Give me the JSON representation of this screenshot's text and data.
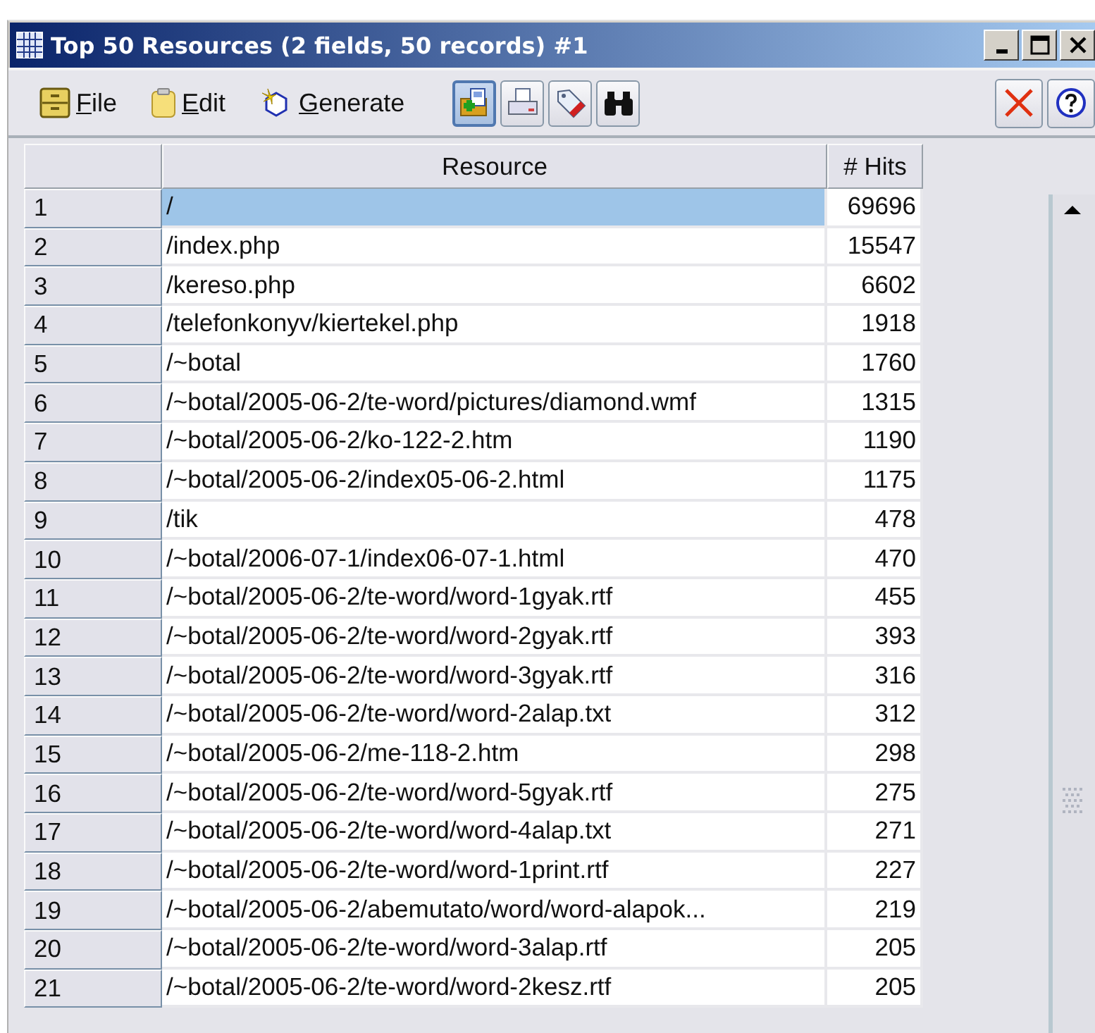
{
  "window": {
    "title": "Top 50 Resources (2 fields, 50 records) #1"
  },
  "menu": [
    {
      "label": "File",
      "kind": "file"
    },
    {
      "label": "Edit",
      "kind": "edit"
    },
    {
      "label": "Generate",
      "kind": "generate"
    }
  ],
  "toolbar": [
    {
      "kind": "add",
      "selected": true
    },
    {
      "kind": "print",
      "selected": false
    },
    {
      "kind": "tag",
      "selected": false
    },
    {
      "kind": "find",
      "selected": false
    }
  ],
  "actions": [
    {
      "kind": "close"
    },
    {
      "kind": "help"
    }
  ],
  "table": {
    "columns": [
      "Resource",
      "# Hits"
    ],
    "rows": [
      {
        "index": "1",
        "resource": "/",
        "hits": "69696",
        "selected": true
      },
      {
        "index": "2",
        "resource": "/index.php",
        "hits": "15547",
        "selected": false
      },
      {
        "index": "3",
        "resource": "/kereso.php",
        "hits": "6602",
        "selected": false
      },
      {
        "index": "4",
        "resource": "/telefonkonyv/kiertekel.php",
        "hits": "1918",
        "selected": false
      },
      {
        "index": "5",
        "resource": "/~botal",
        "hits": "1760",
        "selected": false
      },
      {
        "index": "6",
        "resource": "/~botal/2005-06-2/te-word/pictures/diamond.wmf",
        "hits": "1315",
        "selected": false
      },
      {
        "index": "7",
        "resource": "/~botal/2005-06-2/ko-122-2.htm",
        "hits": "1190",
        "selected": false
      },
      {
        "index": "8",
        "resource": "/~botal/2005-06-2/index05-06-2.html",
        "hits": "1175",
        "selected": false
      },
      {
        "index": "9",
        "resource": "/tik",
        "hits": "478",
        "selected": false
      },
      {
        "index": "10",
        "resource": "/~botal/2006-07-1/index06-07-1.html",
        "hits": "470",
        "selected": false
      },
      {
        "index": "11",
        "resource": "/~botal/2005-06-2/te-word/word-1gyak.rtf",
        "hits": "455",
        "selected": false
      },
      {
        "index": "12",
        "resource": "/~botal/2005-06-2/te-word/word-2gyak.rtf",
        "hits": "393",
        "selected": false
      },
      {
        "index": "13",
        "resource": "/~botal/2005-06-2/te-word/word-3gyak.rtf",
        "hits": "316",
        "selected": false
      },
      {
        "index": "14",
        "resource": "/~botal/2005-06-2/te-word/word-2alap.txt",
        "hits": "312",
        "selected": false
      },
      {
        "index": "15",
        "resource": "/~botal/2005-06-2/me-118-2.htm",
        "hits": "298",
        "selected": false
      },
      {
        "index": "16",
        "resource": "/~botal/2005-06-2/te-word/word-5gyak.rtf",
        "hits": "275",
        "selected": false
      },
      {
        "index": "17",
        "resource": "/~botal/2005-06-2/te-word/word-4alap.txt",
        "hits": "271",
        "selected": false
      },
      {
        "index": "18",
        "resource": "/~botal/2005-06-2/te-word/word-1print.rtf",
        "hits": "227",
        "selected": false
      },
      {
        "index": "19",
        "resource": "/~botal/2005-06-2/abemutato/word/word-alapok...",
        "hits": "219",
        "selected": false
      },
      {
        "index": "20",
        "resource": "/~botal/2005-06-2/te-word/word-3alap.rtf",
        "hits": "205",
        "selected": false
      },
      {
        "index": "21",
        "resource": "/~botal/2005-06-2/te-word/word-2kesz.rtf",
        "hits": "205",
        "selected": false
      }
    ]
  }
}
